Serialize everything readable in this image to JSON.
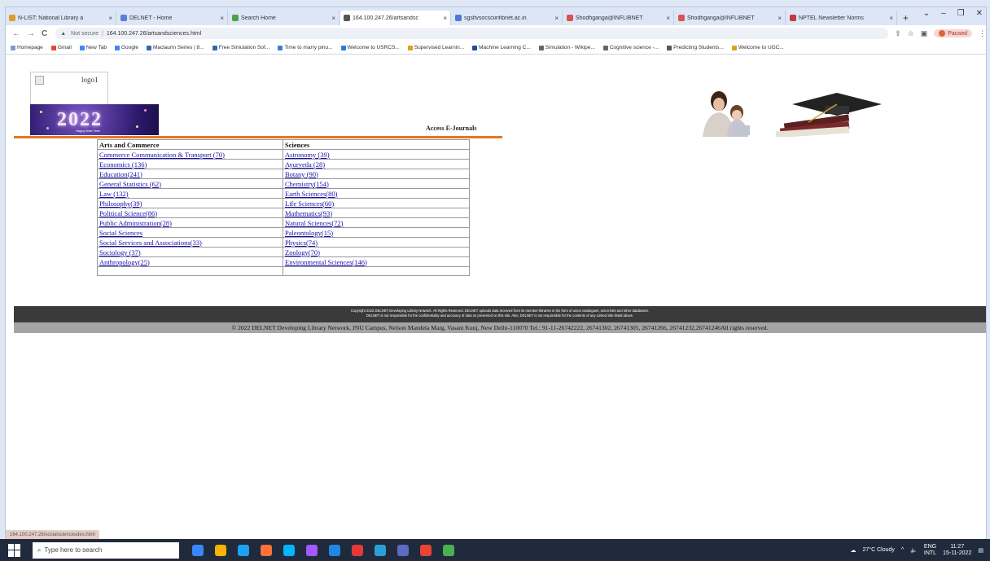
{
  "browser": {
    "tabs": [
      {
        "title": "N-LIST: National Library a",
        "color": "#e39b2c",
        "active": false
      },
      {
        "title": "DELNET - Home",
        "color": "#5b7fd6",
        "active": false
      },
      {
        "title": "Search Home",
        "color": "#4fa04a",
        "active": false
      },
      {
        "title": "164.100.247.26/artsandsc",
        "color": "#555555",
        "active": true
      },
      {
        "title": "sgsltvsocsciinfibnet.ac.in",
        "color": "#4a7bd0",
        "active": false
      },
      {
        "title": "Shodhganga@INFLIBNET",
        "color": "#d9534f",
        "active": false
      },
      {
        "title": "Shodhganga@INFLIBNET",
        "color": "#d9534f",
        "active": false
      },
      {
        "title": "NPTEL Newsletter Norms",
        "color": "#c43a3a",
        "active": false
      }
    ],
    "new_tab": "+",
    "window_controls": {
      "dropdown": "⌄",
      "minimize": "–",
      "restore": "❐",
      "close": "✕"
    },
    "nav": {
      "back": "←",
      "forward": "→",
      "reload": "C"
    },
    "security_label": "Not secure",
    "url": "164.100.247.26/artsandsciences.html",
    "profile_status": "Paused",
    "bookmarks": [
      {
        "label": "Homepage",
        "color": "#7c9bd1"
      },
      {
        "label": "Gmail",
        "color": "#ea4335"
      },
      {
        "label": "New Tab",
        "color": "#4285f4"
      },
      {
        "label": "Google",
        "color": "#4285f4"
      },
      {
        "label": "Maclaurin Series | 8...",
        "color": "#2b6cb0"
      },
      {
        "label": "Free Simulation Sof...",
        "color": "#2b6cb0"
      },
      {
        "label": "Time to marry pinu...",
        "color": "#3b82c4"
      },
      {
        "label": "Welcome to USRCS...",
        "color": "#2e7bd6"
      },
      {
        "label": "Supervised Learnin...",
        "color": "#e0a020"
      },
      {
        "label": "Machine Learning C...",
        "color": "#1f4ea0"
      },
      {
        "label": "Simulation - Wikipe...",
        "color": "#666666"
      },
      {
        "label": "Cognitive science -...",
        "color": "#666666"
      },
      {
        "label": "Predicting Students...",
        "color": "#555555"
      },
      {
        "label": "Welcome to UGC...",
        "color": "#e0a020"
      }
    ]
  },
  "page": {
    "logo_alt": "logo1",
    "banner_year": "2022",
    "banner_sub": "Happy New Year",
    "access_title": "Access E-Journals",
    "table": {
      "headers": [
        "Arts and Commerce",
        "Sciences"
      ],
      "rows": [
        [
          "Commerce Communication & Transport (70)",
          "Astronomy (39)"
        ],
        [
          "Economics (136)",
          "Ayurveda (28)"
        ],
        [
          "Education(241)",
          "Botany (90)"
        ],
        [
          "General Statistics (62)",
          "Chemistry(154)"
        ],
        [
          "Law (132)",
          "Earth Sciences(80)"
        ],
        [
          "Philosophy(39)",
          "Life Sciences(60)"
        ],
        [
          "Political Science(86)",
          "Mathematics(93)"
        ],
        [
          "Public Administration(28)",
          "Natural Sciences(72)"
        ],
        [
          "Social Sciences",
          "Paleontology(15)"
        ],
        [
          "Social Services and Associations(33)",
          "Physics(74)"
        ],
        [
          "Sociology (37)",
          "Zoology(70)"
        ],
        [
          "Anthropology(25)",
          "Environmental Sciences(146)"
        ]
      ]
    },
    "footer_copyright_line1": "Copyright 2022 DELNET-Developing Library Network. All Rights Reserved. DELNET uploads data received from its member-libraries in the form of union catalogues, union-lists and other databases.",
    "footer_copyright_line2": "DELNET is not responsible for the confidentiality and accuracy of data so presented on this site. Also, DELNET is not responsible for the contents of any Linked Site listed above.",
    "footer_address": "© 2022 DELNET Developing Library Network, JNU Campus, Nelson Mandela Marg, Vasant Kunj, New Delhi-110070 Tel.: 91-11-26742222, 26741302, 26741305, 26741266, 26741232,26741246All rights reserved.",
    "status_url": "164.100.247.26/socialsciencesdes.html"
  },
  "taskbar": {
    "search_placeholder": "Type here to search",
    "weather": "27°C Cloudy",
    "lang": "ENG",
    "lang_sub": "INTL",
    "time": "11:27",
    "date": "15-11-2022",
    "apps": [
      "#3a86ff",
      "#f4b400",
      "#1da1f2",
      "#ff7139",
      "#00b7ff",
      "#a259ff",
      "#1e88e5",
      "#e53935",
      "#2a9fd6",
      "#5c6bc0",
      "#ea4335",
      "#4caf50"
    ]
  }
}
